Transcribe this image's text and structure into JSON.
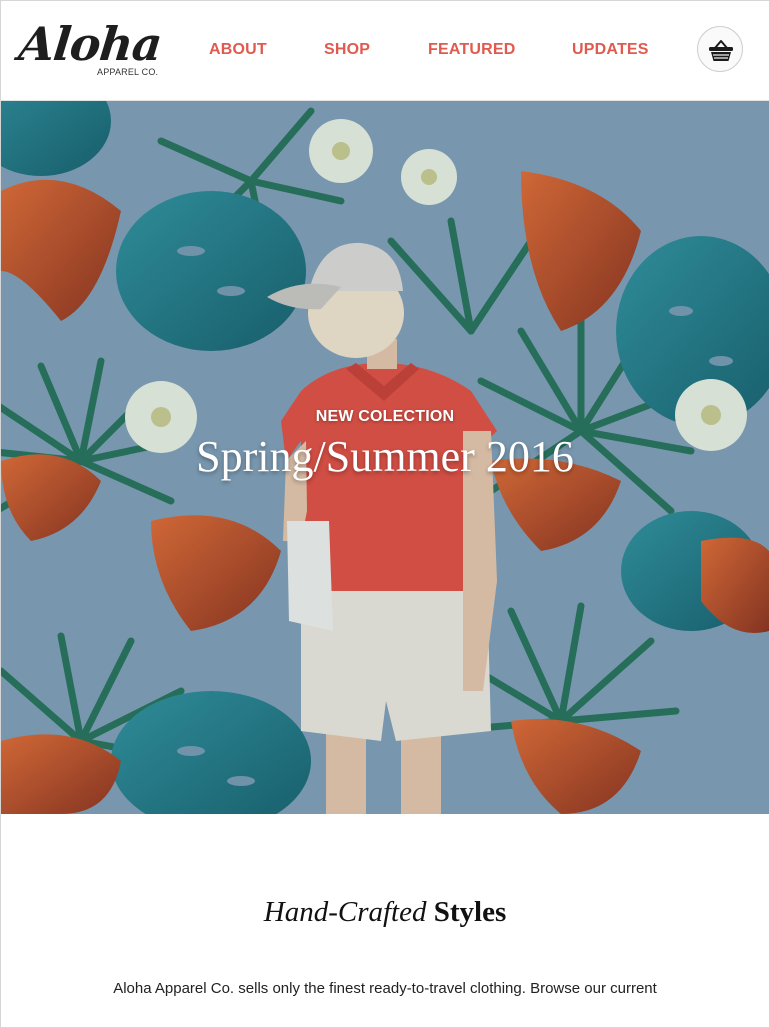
{
  "header": {
    "logo_script": "Aloha",
    "logo_sub": "APPAREL CO.",
    "nav": [
      {
        "label": "ABOUT"
      },
      {
        "label": "SHOP"
      },
      {
        "label": "FEATURED"
      },
      {
        "label": "UPDATES"
      }
    ],
    "cart_icon": "shopping-basket-icon"
  },
  "hero": {
    "kicker": "NEW COLECTION",
    "title": "Spring/Summer 2016"
  },
  "section": {
    "title_italic": "Hand-Crafted",
    "title_bold": "Styles",
    "body": "Aloha Apparel Co. sells only the finest ready-to-travel clothing. Browse our current selection of products or sign-up for updates below."
  },
  "colors": {
    "accent": "#e05a4f",
    "hero_bg": "#7d9bb2",
    "text": "#111111"
  }
}
